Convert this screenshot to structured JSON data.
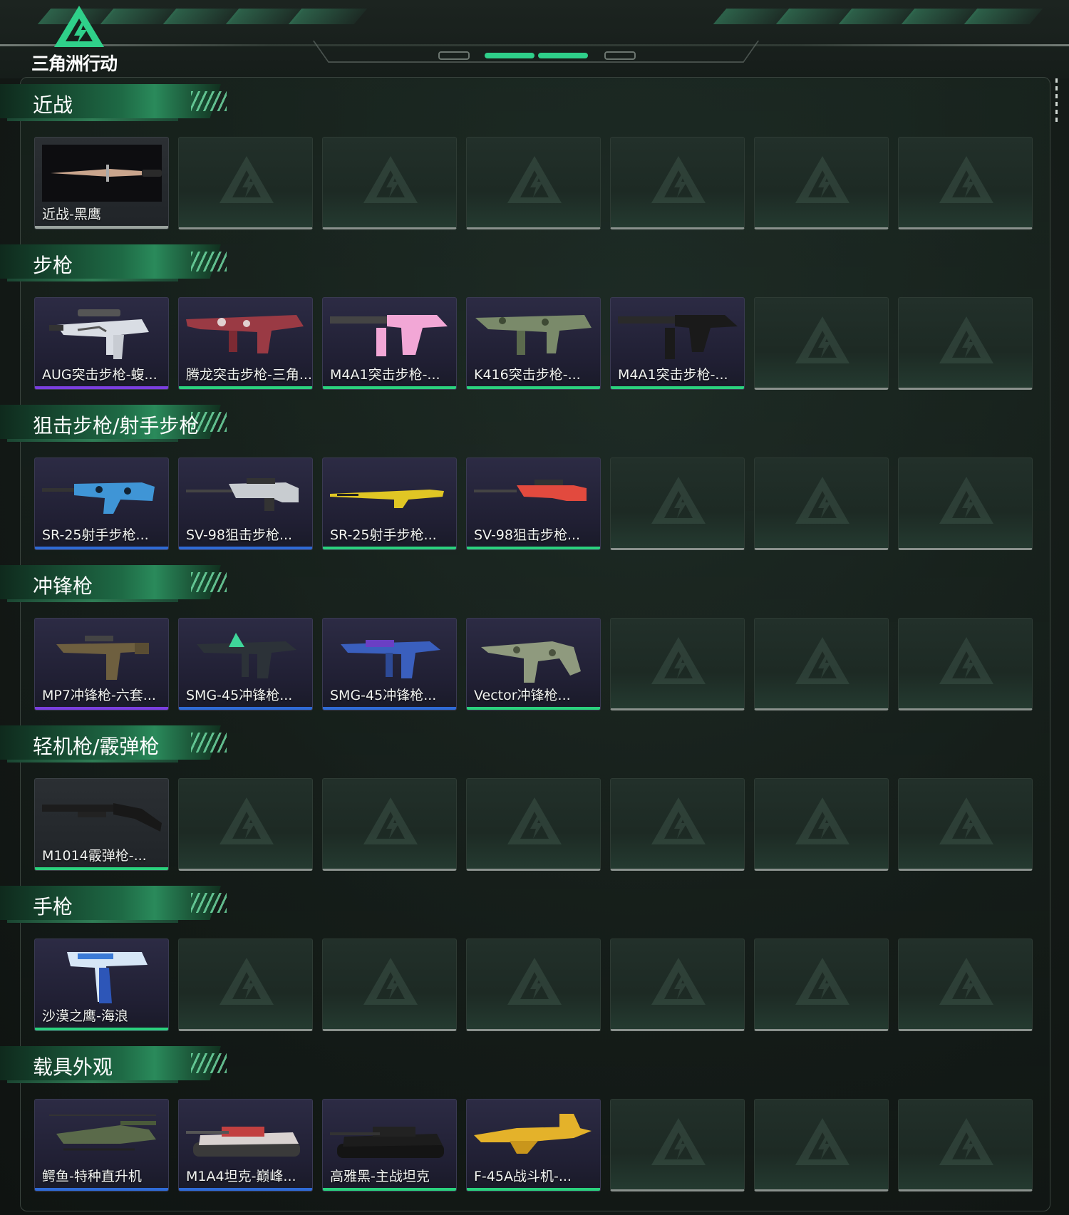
{
  "header": {
    "logo_text": "三角洲行动",
    "accent_color": "#2fd08a"
  },
  "categories": [
    {
      "title": "近战",
      "items": [
        {
          "label": "近战-黑鹰",
          "rarity": "#9aa39e",
          "art": "knife-image"
        }
      ]
    },
    {
      "title": "步枪",
      "items": [
        {
          "label": "AUG突击步枪-蝮...",
          "rarity": "#7b3fe0",
          "art": "aug-rifle-image"
        },
        {
          "label": "腾龙突击步枪-三角...",
          "rarity": "#2bd17e",
          "art": "tenglong-rifle-image"
        },
        {
          "label": "M4A1突击步枪-...",
          "rarity": "#2bd17e",
          "art": "m4a1-pink-rifle-image"
        },
        {
          "label": "K416突击步枪-...",
          "rarity": "#2bd17e",
          "art": "k416-rifle-image"
        },
        {
          "label": "M4A1突击步枪-...",
          "rarity": "#2bd17e",
          "art": "m4a1-black-rifle-image"
        }
      ]
    },
    {
      "title": "狙击步枪/射手步枪",
      "items": [
        {
          "label": "SR-25射手步枪...",
          "rarity": "#2f6bd6",
          "art": "sr25-blue-rifle-image"
        },
        {
          "label": "SV-98狙击步枪...",
          "rarity": "#2f6bd6",
          "art": "sv98-grey-rifle-image"
        },
        {
          "label": "SR-25射手步枪...",
          "rarity": "#2bd17e",
          "art": "sr25-yellow-rifle-image"
        },
        {
          "label": "SV-98狙击步枪...",
          "rarity": "#2bd17e",
          "art": "sv98-red-rifle-image"
        }
      ]
    },
    {
      "title": "冲锋枪",
      "items": [
        {
          "label": "MP7冲锋枪-六套...",
          "rarity": "#7b3fe0",
          "art": "mp7-smg-image"
        },
        {
          "label": "SMG-45冲锋枪...",
          "rarity": "#2f6bd6",
          "art": "smg45-green-image"
        },
        {
          "label": "SMG-45冲锋枪...",
          "rarity": "#2f6bd6",
          "art": "smg45-blue-image"
        },
        {
          "label": "Vector冲锋枪...",
          "rarity": "#2bd17e",
          "art": "vector-smg-image"
        }
      ]
    },
    {
      "title": "轻机枪/霰弹枪",
      "items": [
        {
          "label": "M1014霰弹枪-...",
          "rarity": "#2bd17e",
          "art": "m1014-shotgun-image"
        }
      ]
    },
    {
      "title": "手枪",
      "items": [
        {
          "label": "沙漠之鹰-海浪",
          "rarity": "#2bd17e",
          "art": "desert-eagle-image"
        }
      ]
    },
    {
      "title": "载具外观",
      "items": [
        {
          "label": "鳄鱼-特种直升机",
          "rarity": "#2f6bd6",
          "art": "helicopter-image"
        },
        {
          "label": "M1A4坦克-巅峰...",
          "rarity": "#2f6bd6",
          "art": "tank-red-image"
        },
        {
          "label": "高雅黑-主战坦克",
          "rarity": "#2bd17e",
          "art": "tank-black-image"
        },
        {
          "label": "F-45A战斗机-...",
          "rarity": "#2bd17e",
          "art": "fighter-jet-image"
        }
      ]
    }
  ],
  "empty_slot_icon": "delta-logo-placeholder-icon",
  "slots_per_row": 7
}
